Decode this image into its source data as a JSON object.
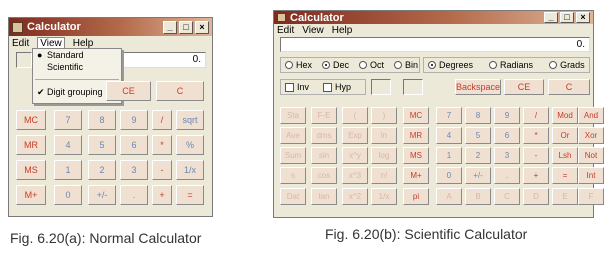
{
  "normal": {
    "title": "Calculator",
    "menu": [
      "Edit",
      "View",
      "Help"
    ],
    "display": "0.",
    "view_menu": [
      "Standard",
      "Scientific",
      "Digit grouping"
    ],
    "top_buttons": [
      "CE",
      "C"
    ],
    "rows": [
      [
        "MC",
        "7",
        "8",
        "9",
        "/",
        "sqrt"
      ],
      [
        "MR",
        "4",
        "5",
        "6",
        "*",
        "%"
      ],
      [
        "MS",
        "1",
        "2",
        "3",
        "-",
        "1/x"
      ],
      [
        "M+",
        "0",
        "+/-",
        ".",
        "+",
        "="
      ]
    ],
    "caption": "Fig. 6.20(a): Normal Calculator"
  },
  "scientific": {
    "title": "Calculator",
    "menu": [
      "Edit",
      "View",
      "Help"
    ],
    "display": "0.",
    "base_options": [
      "Hex",
      "Dec",
      "Oct",
      "Bin"
    ],
    "angle_options": [
      "Degrees",
      "Radians",
      "Grads"
    ],
    "checks": [
      "Inv",
      "Hyp"
    ],
    "top_buttons": [
      "Backspace",
      "CE",
      "C"
    ],
    "rows": [
      [
        "Sta",
        "F-E",
        "(",
        ")",
        "MC",
        "7",
        "8",
        "9",
        "/",
        "Mod",
        "And"
      ],
      [
        "Ave",
        "dms",
        "Exp",
        "ln",
        "MR",
        "4",
        "5",
        "6",
        "*",
        "Or",
        "Xor"
      ],
      [
        "Sum",
        "sin",
        "x^y",
        "log",
        "MS",
        "1",
        "2",
        "3",
        "-",
        "Lsh",
        "Not"
      ],
      [
        "s",
        "cos",
        "x^3",
        "n!",
        "M+",
        "0",
        "+/-",
        ".",
        "+",
        "=",
        "Int"
      ],
      [
        "Dat",
        "tan",
        "x^2",
        "1/x",
        "pi",
        "A",
        "B",
        "C",
        "D",
        "E",
        "F"
      ]
    ],
    "caption": "Fig. 6.20(b): Scientific Calculator"
  }
}
